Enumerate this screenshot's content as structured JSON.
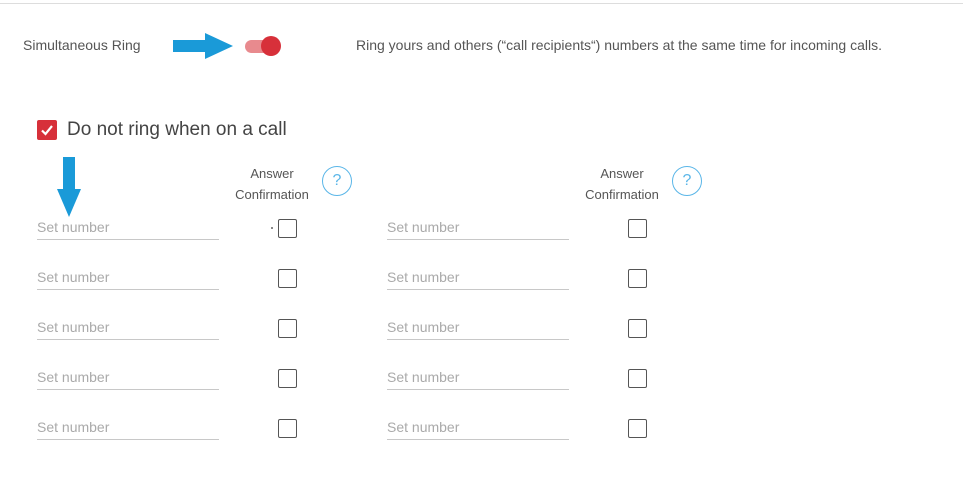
{
  "simultaneous_ring": {
    "label": "Simultaneous Ring",
    "enabled": true,
    "description": "Ring yours and others (“call recipients“) numbers at the same time for incoming calls."
  },
  "do_not_ring": {
    "label": "Do not ring when on a call",
    "checked": true
  },
  "columns": [
    {
      "header_line1": "Answer",
      "header_line2": "Confirmation",
      "help_icon": "?",
      "rows": [
        {
          "placeholder": "Set number",
          "value": "",
          "confirm": false
        },
        {
          "placeholder": "Set number",
          "value": "",
          "confirm": false
        },
        {
          "placeholder": "Set number",
          "value": "",
          "confirm": false
        },
        {
          "placeholder": "Set number",
          "value": "",
          "confirm": false
        },
        {
          "placeholder": "Set number",
          "value": "",
          "confirm": false
        }
      ]
    },
    {
      "header_line1": "Answer",
      "header_line2": "Confirmation",
      "help_icon": "?",
      "rows": [
        {
          "placeholder": "Set number",
          "value": "",
          "confirm": false
        },
        {
          "placeholder": "Set number",
          "value": "",
          "confirm": false
        },
        {
          "placeholder": "Set number",
          "value": "",
          "confirm": false
        },
        {
          "placeholder": "Set number",
          "value": "",
          "confirm": false
        },
        {
          "placeholder": "Set number",
          "value": "",
          "confirm": false
        }
      ]
    }
  ],
  "colors": {
    "accent": "#d7303a",
    "toggle_track": "#e88a8e",
    "help_blue": "#5ab6e8",
    "annotation_arrow": "#1a9ad8"
  },
  "icons": {
    "annotation_right": "arrow-right-icon",
    "annotation_down": "arrow-down-icon",
    "help": "help-circle-icon",
    "check": "checkmark-icon"
  }
}
